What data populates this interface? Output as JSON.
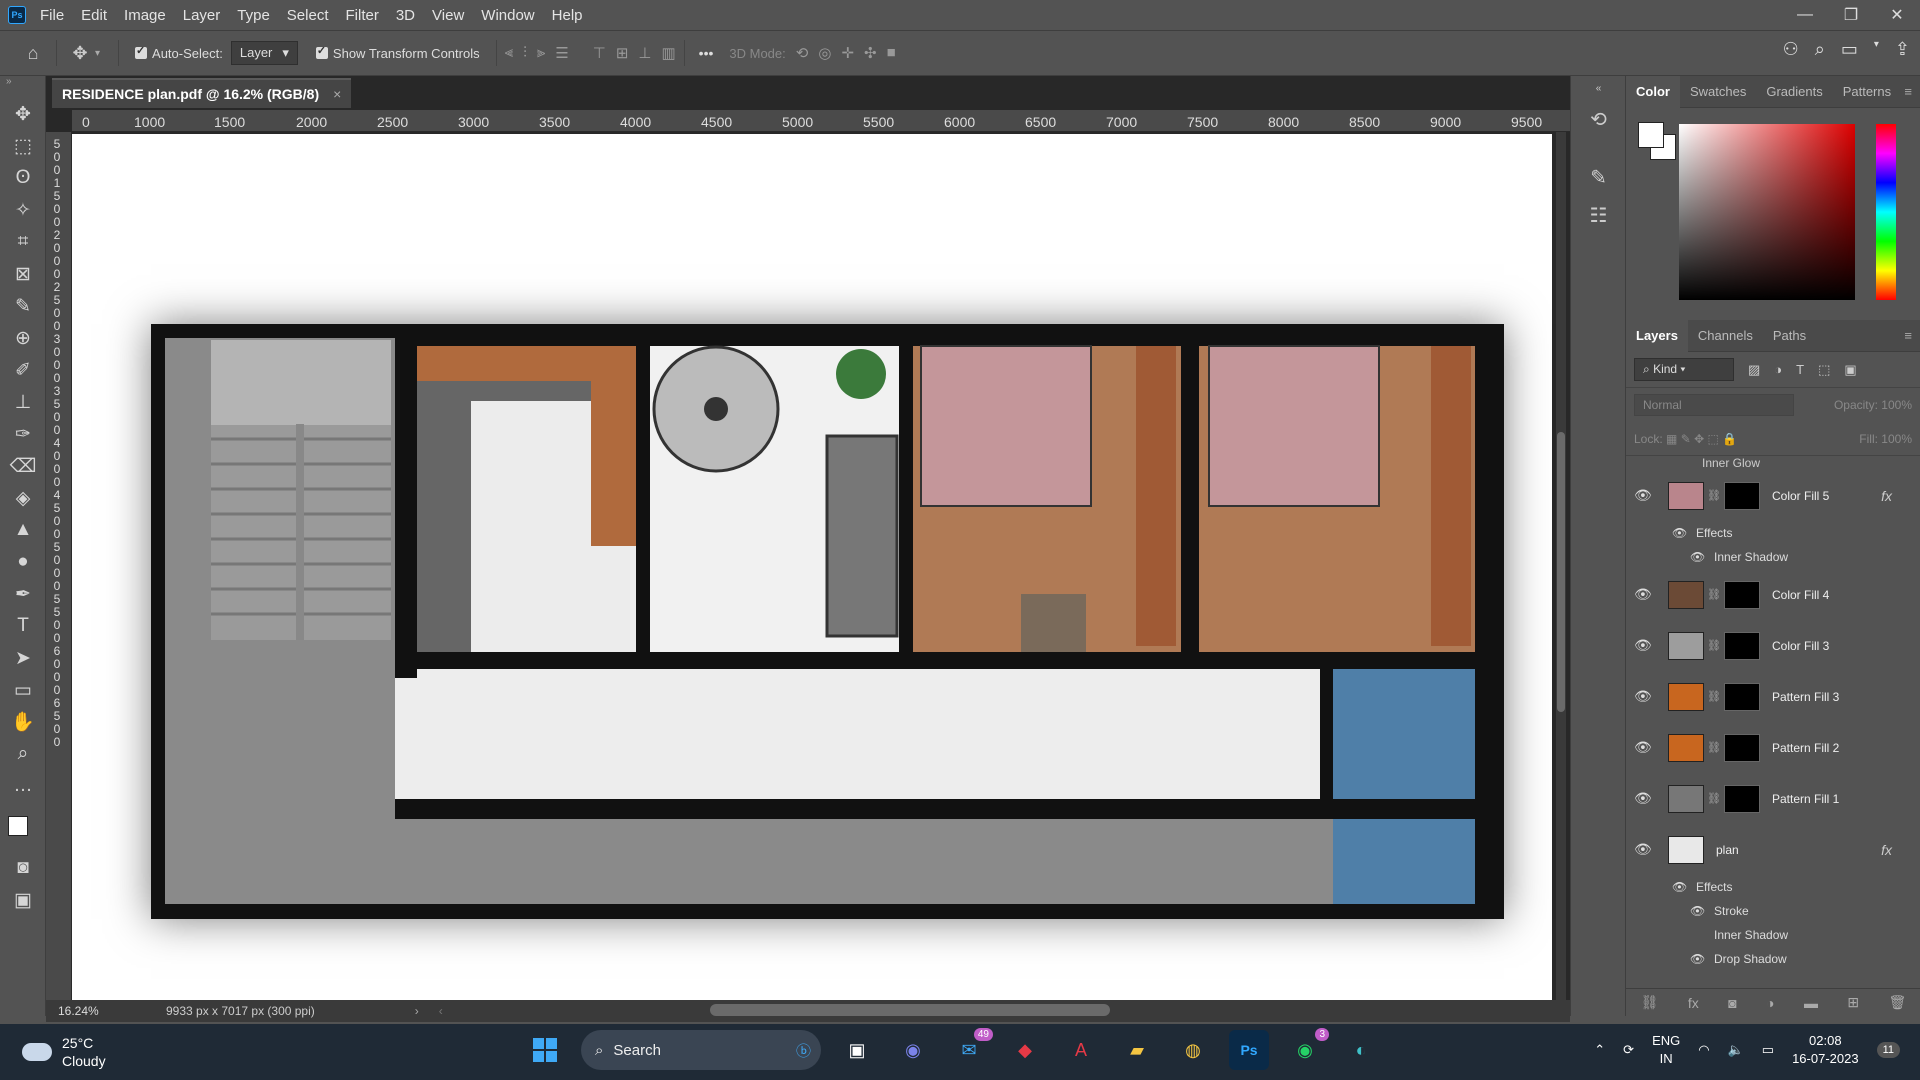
{
  "app": {
    "logo": "Ps",
    "menu": [
      "File",
      "Edit",
      "Image",
      "Layer",
      "Type",
      "Select",
      "Filter",
      "3D",
      "View",
      "Window",
      "Help"
    ]
  },
  "options_bar": {
    "auto_select_label": "Auto-Select:",
    "auto_select_value": "Layer",
    "show_transform_label": "Show Transform Controls",
    "mode_3d_label": "3D Mode:",
    "more": "•••"
  },
  "document": {
    "tab_title": "RESIDENCE plan.pdf @ 16.2% (RGB/8)",
    "ruler_top": [
      "0",
      "1000",
      "1500",
      "2000",
      "2500",
      "3000",
      "3500",
      "4000",
      "4500",
      "5000",
      "5500",
      "6000",
      "6500",
      "7000",
      "7500",
      "8000",
      "8500",
      "9000",
      "9500"
    ],
    "ruler_left": [
      "5",
      "0",
      "0",
      "1",
      "5",
      "0",
      "0",
      "2",
      "0",
      "0",
      "0",
      "2",
      "5",
      "0",
      "0",
      "3",
      "0",
      "0",
      "0",
      "3",
      "5",
      "0",
      "0",
      "4",
      "0",
      "0",
      "0",
      "4",
      "5",
      "0",
      "0",
      "5",
      "0",
      "0",
      "0",
      "5",
      "5",
      "0",
      "0",
      "6",
      "0",
      "0",
      "0",
      "6",
      "5",
      "0",
      "0"
    ]
  },
  "status": {
    "zoom": "16.24%",
    "dimensions": "9933 px x 7017 px (300 ppi)"
  },
  "color_panel": {
    "tabs": [
      "Color",
      "Swatches",
      "Gradients",
      "Patterns"
    ],
    "active": "Color",
    "foreground": "#ffffff",
    "background": "#ffffff"
  },
  "layers_panel": {
    "tabs": [
      "Layers",
      "Channels",
      "Paths"
    ],
    "active": "Layers",
    "kind_label": "Kind",
    "blend_mode": "Normal",
    "opacity_label": "Opacity:",
    "opacity_value": "100%",
    "lock_label": "Lock:",
    "fill_label": "Fill:",
    "fill_value": "100%",
    "top_effect": "Inner Glow",
    "layers": [
      {
        "name": "Color Fill 5",
        "thumb": "#b9858c",
        "fx": "fx",
        "effects_label": "Effects",
        "effects": [
          "Inner Shadow"
        ]
      },
      {
        "name": "Color Fill 4",
        "thumb": "#6b4a36",
        "fx": "",
        "effects_label": "",
        "effects": []
      },
      {
        "name": "Color Fill 3",
        "thumb": "#9d9d9d",
        "fx": "",
        "effects_label": "",
        "effects": []
      },
      {
        "name": "Pattern Fill 3",
        "thumb": "#c8661f",
        "fx": "",
        "effects_label": "",
        "effects": []
      },
      {
        "name": "Pattern Fill 2",
        "thumb": "#c8661f",
        "fx": "",
        "effects_label": "",
        "effects": []
      },
      {
        "name": "Pattern Fill 1",
        "thumb": "#777777",
        "fx": "",
        "effects_label": "",
        "effects": []
      },
      {
        "name": "plan",
        "thumb": "#e8e8e8",
        "fx": "fx",
        "effects_label": "Effects",
        "effects": [
          "Stroke",
          "Inner Shadow",
          "Drop Shadow"
        ]
      }
    ]
  },
  "taskbar": {
    "temperature": "25°C",
    "condition": "Cloudy",
    "search": "Search",
    "mail_badge": "49",
    "whatsapp_badge": "3",
    "lang1": "ENG",
    "lang2": "IN",
    "time": "02:08",
    "date": "16-07-2023",
    "notification_badge": "11"
  }
}
